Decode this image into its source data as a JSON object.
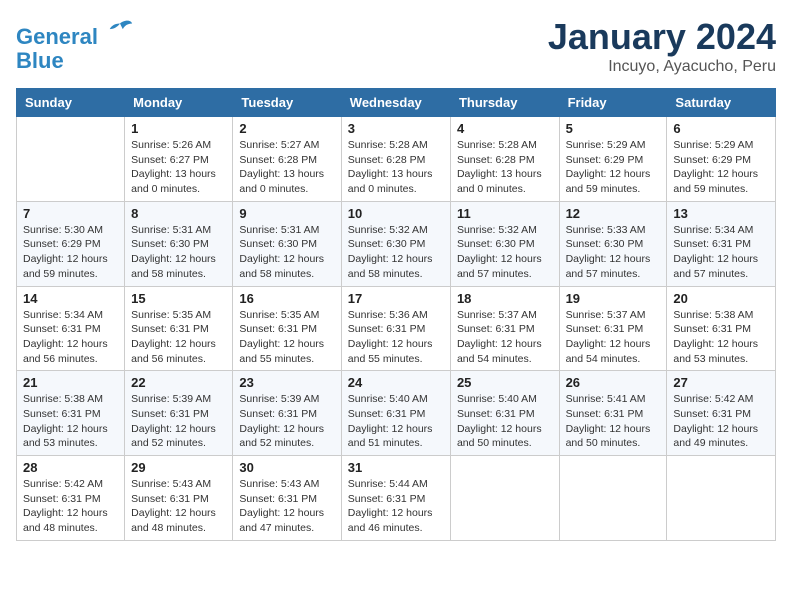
{
  "header": {
    "logo_line1": "General",
    "logo_line2": "Blue",
    "main_title": "January 2024",
    "subtitle": "Incuyo, Ayacucho, Peru"
  },
  "calendar": {
    "days_of_week": [
      "Sunday",
      "Monday",
      "Tuesday",
      "Wednesday",
      "Thursday",
      "Friday",
      "Saturday"
    ],
    "weeks": [
      [
        {
          "day": "",
          "info": ""
        },
        {
          "day": "1",
          "info": "Sunrise: 5:26 AM\nSunset: 6:27 PM\nDaylight: 13 hours\nand 0 minutes."
        },
        {
          "day": "2",
          "info": "Sunrise: 5:27 AM\nSunset: 6:28 PM\nDaylight: 13 hours\nand 0 minutes."
        },
        {
          "day": "3",
          "info": "Sunrise: 5:28 AM\nSunset: 6:28 PM\nDaylight: 13 hours\nand 0 minutes."
        },
        {
          "day": "4",
          "info": "Sunrise: 5:28 AM\nSunset: 6:28 PM\nDaylight: 13 hours\nand 0 minutes."
        },
        {
          "day": "5",
          "info": "Sunrise: 5:29 AM\nSunset: 6:29 PM\nDaylight: 12 hours\nand 59 minutes."
        },
        {
          "day": "6",
          "info": "Sunrise: 5:29 AM\nSunset: 6:29 PM\nDaylight: 12 hours\nand 59 minutes."
        }
      ],
      [
        {
          "day": "7",
          "info": "Sunrise: 5:30 AM\nSunset: 6:29 PM\nDaylight: 12 hours\nand 59 minutes."
        },
        {
          "day": "8",
          "info": "Sunrise: 5:31 AM\nSunset: 6:30 PM\nDaylight: 12 hours\nand 58 minutes."
        },
        {
          "day": "9",
          "info": "Sunrise: 5:31 AM\nSunset: 6:30 PM\nDaylight: 12 hours\nand 58 minutes."
        },
        {
          "day": "10",
          "info": "Sunrise: 5:32 AM\nSunset: 6:30 PM\nDaylight: 12 hours\nand 58 minutes."
        },
        {
          "day": "11",
          "info": "Sunrise: 5:32 AM\nSunset: 6:30 PM\nDaylight: 12 hours\nand 57 minutes."
        },
        {
          "day": "12",
          "info": "Sunrise: 5:33 AM\nSunset: 6:30 PM\nDaylight: 12 hours\nand 57 minutes."
        },
        {
          "day": "13",
          "info": "Sunrise: 5:34 AM\nSunset: 6:31 PM\nDaylight: 12 hours\nand 57 minutes."
        }
      ],
      [
        {
          "day": "14",
          "info": "Sunrise: 5:34 AM\nSunset: 6:31 PM\nDaylight: 12 hours\nand 56 minutes."
        },
        {
          "day": "15",
          "info": "Sunrise: 5:35 AM\nSunset: 6:31 PM\nDaylight: 12 hours\nand 56 minutes."
        },
        {
          "day": "16",
          "info": "Sunrise: 5:35 AM\nSunset: 6:31 PM\nDaylight: 12 hours\nand 55 minutes."
        },
        {
          "day": "17",
          "info": "Sunrise: 5:36 AM\nSunset: 6:31 PM\nDaylight: 12 hours\nand 55 minutes."
        },
        {
          "day": "18",
          "info": "Sunrise: 5:37 AM\nSunset: 6:31 PM\nDaylight: 12 hours\nand 54 minutes."
        },
        {
          "day": "19",
          "info": "Sunrise: 5:37 AM\nSunset: 6:31 PM\nDaylight: 12 hours\nand 54 minutes."
        },
        {
          "day": "20",
          "info": "Sunrise: 5:38 AM\nSunset: 6:31 PM\nDaylight: 12 hours\nand 53 minutes."
        }
      ],
      [
        {
          "day": "21",
          "info": "Sunrise: 5:38 AM\nSunset: 6:31 PM\nDaylight: 12 hours\nand 53 minutes."
        },
        {
          "day": "22",
          "info": "Sunrise: 5:39 AM\nSunset: 6:31 PM\nDaylight: 12 hours\nand 52 minutes."
        },
        {
          "day": "23",
          "info": "Sunrise: 5:39 AM\nSunset: 6:31 PM\nDaylight: 12 hours\nand 52 minutes."
        },
        {
          "day": "24",
          "info": "Sunrise: 5:40 AM\nSunset: 6:31 PM\nDaylight: 12 hours\nand 51 minutes."
        },
        {
          "day": "25",
          "info": "Sunrise: 5:40 AM\nSunset: 6:31 PM\nDaylight: 12 hours\nand 50 minutes."
        },
        {
          "day": "26",
          "info": "Sunrise: 5:41 AM\nSunset: 6:31 PM\nDaylight: 12 hours\nand 50 minutes."
        },
        {
          "day": "27",
          "info": "Sunrise: 5:42 AM\nSunset: 6:31 PM\nDaylight: 12 hours\nand 49 minutes."
        }
      ],
      [
        {
          "day": "28",
          "info": "Sunrise: 5:42 AM\nSunset: 6:31 PM\nDaylight: 12 hours\nand 48 minutes."
        },
        {
          "day": "29",
          "info": "Sunrise: 5:43 AM\nSunset: 6:31 PM\nDaylight: 12 hours\nand 48 minutes."
        },
        {
          "day": "30",
          "info": "Sunrise: 5:43 AM\nSunset: 6:31 PM\nDaylight: 12 hours\nand 47 minutes."
        },
        {
          "day": "31",
          "info": "Sunrise: 5:44 AM\nSunset: 6:31 PM\nDaylight: 12 hours\nand 46 minutes."
        },
        {
          "day": "",
          "info": ""
        },
        {
          "day": "",
          "info": ""
        },
        {
          "day": "",
          "info": ""
        }
      ]
    ]
  }
}
